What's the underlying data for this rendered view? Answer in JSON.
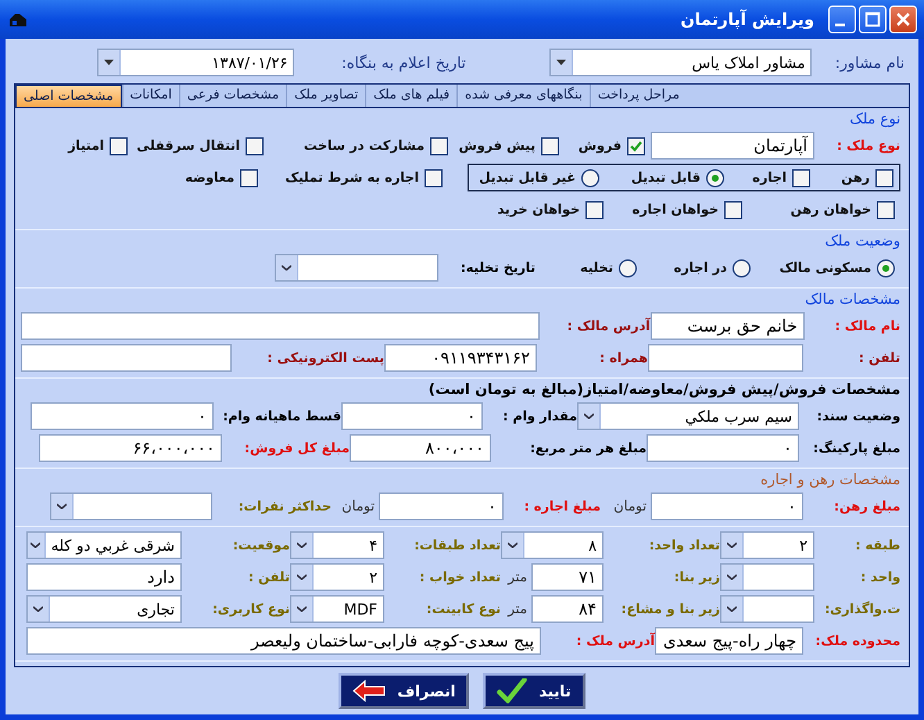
{
  "window": {
    "title": "ویرایش آپارتمان"
  },
  "header": [
    {
      "kind": "label",
      "text": "نام مشاور:"
    },
    {
      "kind": "combo",
      "value": "مشاور املاک یاس"
    },
    {
      "kind": "label",
      "text": "تاریخ اعلام به بنگاه:"
    },
    {
      "kind": "combo",
      "value": "۱۳۸۷/۰۱/۲۶"
    }
  ],
  "tabs": [
    {
      "label": "مراحل پرداخت",
      "selected": false
    },
    {
      "label": "بنگاههای معرفی شده",
      "selected": false
    },
    {
      "label": "فیلم های ملک",
      "selected": false
    },
    {
      "label": "تصاویر ملک",
      "selected": false
    },
    {
      "label": "مشخصات فرعی",
      "selected": false
    },
    {
      "label": "امکانات",
      "selected": false
    },
    {
      "label": "مشخصات اصلی",
      "selected": true
    }
  ],
  "sections": [
    {
      "kind": "type",
      "title": "نوع ملک",
      "lines": [
        {
          "items": [
            {
              "kind": "label",
              "text": "نوع ملک :",
              "required": true
            },
            {
              "kind": "text",
              "value": "آپارتمان"
            },
            {
              "kind": "check",
              "text": "فروش",
              "checked": true
            },
            {
              "kind": "check",
              "text": "پیش فروش",
              "checked": false
            },
            {
              "kind": "check",
              "text": "مشارکت در ساخت",
              "checked": false
            },
            {
              "kind": "check",
              "text": "انتقال سرقفلی",
              "checked": false
            },
            {
              "kind": "check",
              "text": "امتیاز",
              "checked": false
            }
          ]
        },
        {
          "items": [
            {
              "kind": "group",
              "items": [
                {
                  "kind": "check",
                  "text": "رهن",
                  "checked": false
                },
                {
                  "kind": "check",
                  "text": "اجاره",
                  "checked": false
                },
                {
                  "kind": "radio",
                  "text": "قابل تبدیل",
                  "selected": true
                },
                {
                  "kind": "radio",
                  "text": "غیر قابل تبدیل",
                  "selected": false
                }
              ]
            },
            {
              "kind": "check",
              "text": "اجاره به شرط تملیک",
              "checked": false
            },
            {
              "kind": "check",
              "text": "معاوضه",
              "checked": false
            }
          ]
        },
        {
          "items": [
            {
              "kind": "check",
              "text": "خواهان رهن",
              "checked": false
            },
            {
              "kind": "check",
              "text": "خواهان اجاره",
              "checked": false
            },
            {
              "kind": "check",
              "text": "خواهان خرید",
              "checked": false
            }
          ]
        }
      ]
    },
    {
      "kind": "status",
      "title": "وضعیت ملک",
      "lines": [
        {
          "items": [
            {
              "kind": "radio",
              "text": "مسکونی مالک",
              "selected": true
            },
            {
              "kind": "radio",
              "text": "در اجاره",
              "selected": false
            },
            {
              "kind": "radio",
              "text": "تخلیه",
              "selected": false
            },
            {
              "kind": "label",
              "text": "تاریخ تخلیه:",
              "required": false
            },
            {
              "kind": "combo"
            }
          ]
        }
      ]
    },
    {
      "kind": "owner",
      "title": "مشخصات مالک",
      "lines": [
        {
          "items": [
            {
              "kind": "label",
              "text": "نام مالک :",
              "required": true
            },
            {
              "kind": "text",
              "value": "خانم حق برست"
            },
            {
              "kind": "label",
              "text": "آدرس مالک :",
              "required": false
            },
            {
              "kind": "text"
            }
          ]
        },
        {
          "items": [
            {
              "kind": "label",
              "text": "تلفن :",
              "required": false
            },
            {
              "kind": "text"
            },
            {
              "kind": "label",
              "text": "همراه :",
              "required": false
            },
            {
              "kind": "text",
              "value": "۰۹۱۱۹۳۴۳۱۶۲"
            },
            {
              "kind": "label",
              "text": "پست الکترونیکی :",
              "required": false
            },
            {
              "kind": "text"
            }
          ]
        }
      ]
    },
    {
      "kind": "sale",
      "title": "مشخصات فروش/پیش فروش/معاوضه/امتیاز(مبالغ به تومان است)",
      "lines": [
        {
          "items": [
            {
              "kind": "label",
              "text": "وضعیت سند:",
              "required": false
            },
            {
              "kind": "combo",
              "value": "سیم سرب ملکي"
            },
            {
              "kind": "label",
              "text": "مقدار وام :",
              "required": false
            },
            {
              "kind": "text",
              "value": "۰"
            },
            {
              "kind": "label",
              "text": "قسط ماهیانه وام:",
              "required": false
            },
            {
              "kind": "text",
              "value": "۰"
            }
          ]
        },
        {
          "items": [
            {
              "kind": "label",
              "text": "مبلغ پارکینگ:",
              "required": false
            },
            {
              "kind": "text",
              "value": "۰"
            },
            {
              "kind": "label",
              "text": "مبلغ هر متر مربع:",
              "required": false
            },
            {
              "kind": "text",
              "value": "۸۰۰،۰۰۰"
            },
            {
              "kind": "label",
              "text": "مبلغ کل فروش:",
              "required": true
            },
            {
              "kind": "text",
              "value": "۶۶،۰۰۰،۰۰۰"
            }
          ]
        }
      ]
    },
    {
      "kind": "rent",
      "title": "مشخصات رهن و اجاره",
      "lines": [
        {
          "items": [
            {
              "kind": "label",
              "text": "مبلغ رهن:",
              "required": true
            },
            {
              "kind": "text",
              "value": "۰"
            },
            {
              "kind": "unit",
              "text": "تومان"
            },
            {
              "kind": "label",
              "text": "مبلغ اجاره :",
              "required": true
            },
            {
              "kind": "text",
              "value": "۰"
            },
            {
              "kind": "unit",
              "text": "تومان"
            },
            {
              "kind": "label",
              "text": "حداکثر نفرات:",
              "required": false
            },
            {
              "kind": "combo"
            }
          ]
        }
      ]
    },
    {
      "kind": "building",
      "lines": [
        {
          "items": [
            {
              "kind": "label",
              "text": "طبقه :",
              "required": false
            },
            {
              "kind": "combo",
              "value": "۲"
            },
            {
              "kind": "label",
              "text": "تعداد واحد:",
              "required": false
            },
            {
              "kind": "combo",
              "value": "۸"
            },
            {
              "kind": "label",
              "text": "تعداد طبقات:",
              "required": false
            },
            {
              "kind": "combo",
              "value": "۴"
            },
            {
              "kind": "label",
              "text": "موقعیت:",
              "required": false
            },
            {
              "kind": "combo",
              "value": "شرقی غربي دو کله"
            }
          ]
        },
        {
          "items": [
            {
              "kind": "label",
              "text": "واحد :",
              "required": false
            },
            {
              "kind": "combo"
            },
            {
              "kind": "label",
              "text": "زیر بنا:",
              "required": false
            },
            {
              "kind": "text",
              "value": "۷۱"
            },
            {
              "kind": "unit",
              "text": "متر"
            },
            {
              "kind": "label",
              "text": "تعداد خواب :",
              "required": false
            },
            {
              "kind": "combo",
              "value": "۲"
            },
            {
              "kind": "label",
              "text": "تلفن :",
              "required": false
            },
            {
              "kind": "text",
              "value": "دارد"
            }
          ]
        },
        {
          "items": [
            {
              "kind": "label",
              "text": "ت.واگذاری:",
              "required": false
            },
            {
              "kind": "combo"
            },
            {
              "kind": "label",
              "text": "زیر بنا و مشاع:",
              "required": false
            },
            {
              "kind": "text",
              "value": "۸۴"
            },
            {
              "kind": "unit",
              "text": "متر"
            },
            {
              "kind": "label",
              "text": "نوع کابینت:",
              "required": false
            },
            {
              "kind": "combo",
              "value": "MDF"
            },
            {
              "kind": "label",
              "text": "نوع کاربری:",
              "required": false
            },
            {
              "kind": "combo",
              "value": "تجاری"
            }
          ]
        },
        {
          "items": [
            {
              "kind": "label",
              "text": "محدوده ملک:",
              "required": true
            },
            {
              "kind": "text",
              "value": "چهار راه-پیج سعدی"
            },
            {
              "kind": "label",
              "text": "آدرس ملک :",
              "required": true
            },
            {
              "kind": "text",
              "value": "پیج سعدی-کوچه فارابی-ساختمان ولیعصر"
            }
          ]
        }
      ]
    }
  ],
  "buttons": [
    {
      "kind": "ok",
      "label": "تایید"
    },
    {
      "kind": "cancel",
      "label": "انصراف"
    }
  ]
}
